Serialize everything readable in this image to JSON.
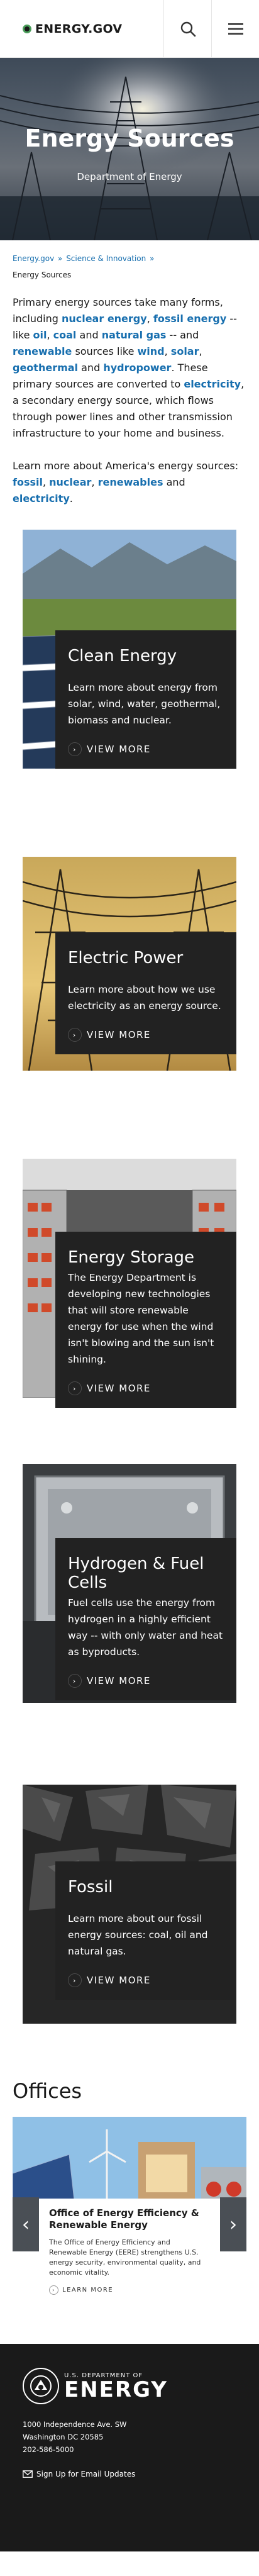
{
  "header": {
    "logo_text": "ENERGY.GOV",
    "search_icon": "search-icon",
    "menu_icon": "hamburger-menu-icon"
  },
  "hero": {
    "title": "Energy Sources",
    "subtitle": "Department of Energy"
  },
  "breadcrumb": {
    "items": [
      "Energy.gov",
      "Science & Innovation"
    ],
    "current": "Energy Sources"
  },
  "intro": {
    "p1_a": "Primary energy sources take many forms, including ",
    "nuclear_energy": "nuclear energy",
    "comma1": ", ",
    "fossil_energy": "fossil energy",
    "p1_b": " -- like ",
    "oil": "oil",
    "comma2": ", ",
    "coal": "coal",
    "and1": " and ",
    "natural_gas": "natural gas",
    "p1_c": " -- and ",
    "renewable": "renewable",
    "p1_d": " sources like ",
    "wind": "wind",
    "comma3": ", ",
    "solar": "solar",
    "comma4": ", ",
    "geothermal": "geothermal",
    "and2": " and ",
    "hydropower": "hydropower",
    "p1_e": ". These primary sources are converted to ",
    "electricity": "electricity",
    "p1_f": ", a secondary energy source, which flows through power lines and other transmission infrastructure to your home and business.",
    "p2_a": "Learn more about America's energy sources: ",
    "fossil": "fossil",
    "comma5": ", ",
    "nuclear": "nuclear",
    "comma6": ", ",
    "renewables": "renewables",
    "and3": " and ",
    "electricity2": "electricity",
    "period": "."
  },
  "cards": [
    {
      "title": "Clean Energy",
      "text": "Learn more about energy from solar, wind, water, geothermal, biomass and nuclear.",
      "more": "VIEW MORE"
    },
    {
      "title": "Electric Power",
      "text": "Learn more about how we use electricity as an energy source.",
      "more": "VIEW MORE"
    },
    {
      "title": "Energy Storage",
      "text": "The Energy Department is developing new technologies that will store renewable energy for use when the wind isn't blowing and the sun isn't shining.",
      "more": "VIEW MORE"
    },
    {
      "title": "Hydrogen & Fuel Cells",
      "text": "Fuel cells use the energy from hydrogen in a highly efficient way -- with only water and heat as byproducts.",
      "more": "VIEW MORE"
    },
    {
      "title": "Fossil",
      "text": "Learn more about our fossil energy sources: coal, oil and natural gas.",
      "more": "VIEW MORE"
    }
  ],
  "offices": {
    "title": "Offices",
    "item": {
      "title": "Office of Energy Efficiency & Renewable Energy",
      "text": "The Office of Energy Efficiency and Renewable Energy (EERE) strengthens U.S. energy security, environmental quality, and economic vitality.",
      "more": "LEARN MORE"
    },
    "prev_icon": "chevron-left-icon",
    "next_icon": "chevron-right-icon"
  },
  "footer": {
    "logo_small": "U.S. DEPARTMENT OF",
    "logo_big": "ENERGY",
    "address_line1": "1000 Independence Ave. SW",
    "address_line2": "Washington DC 20585",
    "phone": "202-586-5000",
    "signup": "Sign Up for Email Updates"
  }
}
